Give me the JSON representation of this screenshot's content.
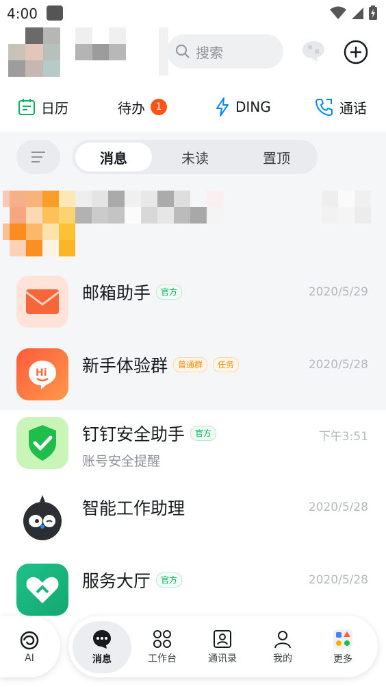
{
  "status_bar": {
    "time": "4:00"
  },
  "header": {
    "search_placeholder": "搜索"
  },
  "shortcuts": [
    {
      "label": "日历"
    },
    {
      "label": "待办",
      "badge": "1"
    },
    {
      "label": "DING"
    },
    {
      "label": "通话"
    }
  ],
  "tabs": [
    {
      "label": "消息",
      "active": true
    },
    {
      "label": "未读"
    },
    {
      "label": "置顶"
    }
  ],
  "conversations": [
    {
      "title": "邮箱助手",
      "tags": [
        "官方"
      ],
      "date": "2020/5/29",
      "subtitle": ""
    },
    {
      "title": "新手体验群",
      "tags": [
        "普通群",
        "任务"
      ],
      "date": "2020/5/28",
      "subtitle": ""
    },
    {
      "title": "钉钉安全助手",
      "tags": [
        "官方"
      ],
      "date": "下午3:51",
      "subtitle": "账号安全提醒"
    },
    {
      "title": "智能工作助理",
      "tags": [],
      "date": "2020/5/28",
      "subtitle": ""
    },
    {
      "title": "服务大厅",
      "tags": [
        "官方"
      ],
      "date": "2020/5/28",
      "subtitle": ""
    }
  ],
  "bottom_nav": [
    {
      "label": "AI"
    },
    {
      "label": "消息",
      "active": true
    },
    {
      "label": "工作台"
    },
    {
      "label": "通讯录"
    },
    {
      "label": "我的"
    },
    {
      "label": "更多"
    }
  ],
  "colors": {
    "accent": "#0089ff",
    "badge": "#ff5219",
    "official_tag": "#00b35a",
    "group_tag": "#ff8a00",
    "calendar_icon": "#00b35a"
  }
}
